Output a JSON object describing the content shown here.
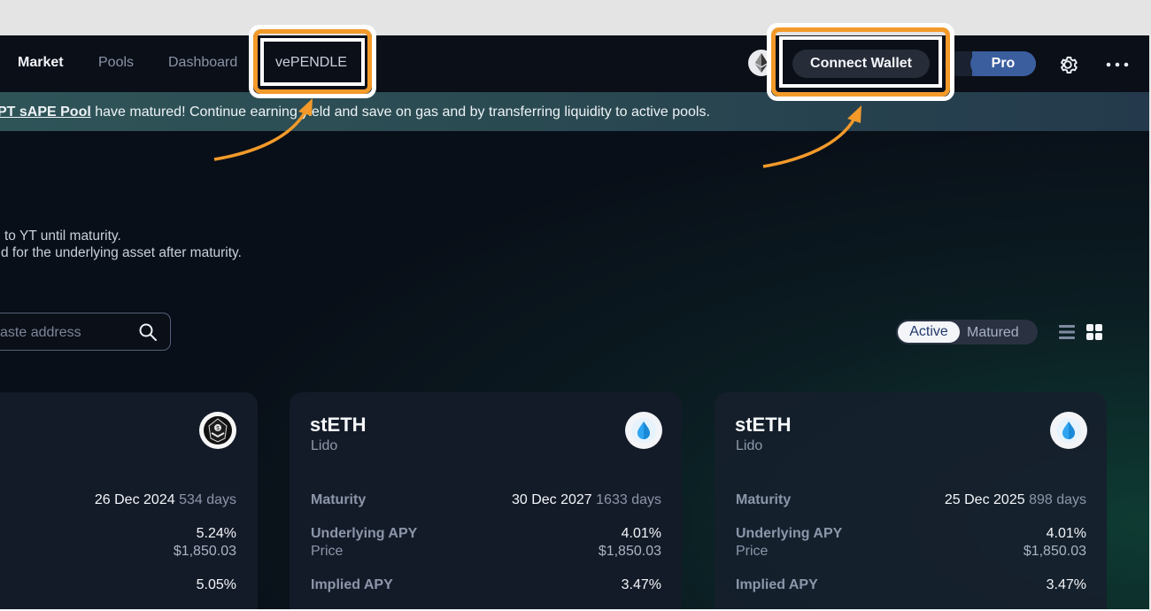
{
  "nav": {
    "links": [
      "Market",
      "Pools",
      "Dashboard",
      "vePENDLE"
    ],
    "connect_wallet": "Connect Wallet",
    "pro": "Pro"
  },
  "banner": {
    "pool": "PT sAPE Pool",
    "message": " have matured! Continue earning yield and save on gas and by transferring liquidity to active pools."
  },
  "description": {
    "line1": "to YT until maturity.",
    "line2": "d for the underlying asset after maturity."
  },
  "search": {
    "placeholder": "aste address"
  },
  "filter": {
    "active": "Active",
    "matured": "Matured"
  },
  "cards": [
    {
      "maturity_date": "26 Dec 2024",
      "maturity_days": "534 days",
      "underlying_apy": "5.24%",
      "price": "$1,850.03",
      "implied_apy": "5.05%",
      "icon": "ape-token-icon"
    },
    {
      "title": "stETH",
      "subtitle": "Lido",
      "maturity_label": "Maturity",
      "maturity_date": "30 Dec 2027",
      "maturity_days": "1633 days",
      "underlying_label": "Underlying APY",
      "underlying_apy": "4.01%",
      "price_label": "Price",
      "price": "$1,850.03",
      "implied_label": "Implied APY",
      "implied_apy": "3.47%",
      "icon": "lido-drop-icon"
    },
    {
      "title": "stETH",
      "subtitle": "Lido",
      "maturity_label": "Maturity",
      "maturity_date": "25 Dec 2025",
      "maturity_days": "898 days",
      "underlying_label": "Underlying APY",
      "underlying_apy": "4.01%",
      "price_label": "Price",
      "price": "$1,850.03",
      "implied_label": "Implied APY",
      "implied_apy": "3.47%",
      "icon": "lido-drop-icon"
    }
  ],
  "colors": {
    "highlight": "#f39a2a",
    "background": "#090f18",
    "card": "#141b28",
    "pro": "#3b5e9e"
  }
}
